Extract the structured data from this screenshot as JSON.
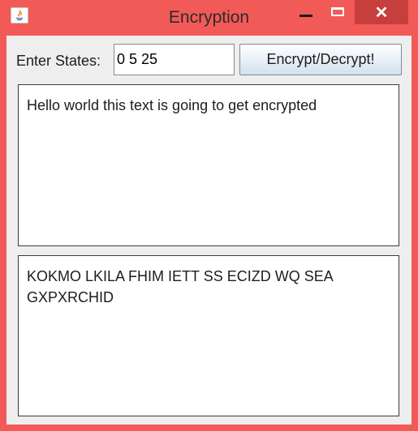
{
  "window": {
    "title": "Encryption",
    "close_glyph": "✕",
    "colors": {
      "frame": "#f25a57",
      "close_hover": "#c63f3c",
      "content_bg": "#eeeeee"
    }
  },
  "controls": {
    "states_label": "Enter States:",
    "states_value": "0 5 25",
    "action_label": "Encrypt/Decrypt!"
  },
  "input_text": "Hello world this text is going to get encrypted",
  "output_text": "KOKMO LKILA FHIM IETT SS ECIZD WQ SEA GXPXRCHID",
  "icons": [
    "java-app-icon",
    "minimize-icon",
    "maximize-icon",
    "close-icon"
  ]
}
